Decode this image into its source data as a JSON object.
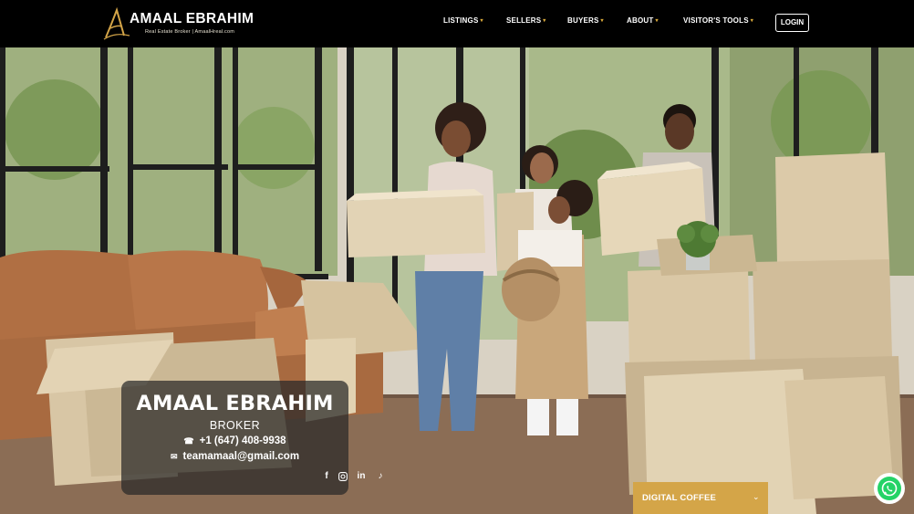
{
  "header": {
    "logo": {
      "name": "AMAAL EBRAHIM",
      "tagline": "Real Estate Broker  |  AmaalHreal.com",
      "mark_script": "A Real"
    },
    "nav": [
      {
        "label": "LISTINGS",
        "has_dropdown": true
      },
      {
        "label": "SELLERS",
        "has_dropdown": true
      },
      {
        "label": "BUYERS",
        "has_dropdown": true
      },
      {
        "label": "ABOUT",
        "has_dropdown": true
      },
      {
        "label": "VISITOR'S TOOLS",
        "has_dropdown": true
      }
    ],
    "login_label": "LOGIN"
  },
  "card": {
    "name": "AMAAL EBRAHIM",
    "role": "BROKER",
    "phone": "+1 (647) 408-9938",
    "email": "teamamaal@gmail.com",
    "socials": [
      "facebook-icon",
      "instagram-icon",
      "linkedin-icon",
      "tiktok-icon"
    ]
  },
  "coffee": {
    "label": "DIGITAL COFFEE"
  },
  "whatsapp": {
    "icon": "whatsapp-icon"
  },
  "colors": {
    "header_bg": "#000000",
    "accent_gold": "#d4a548",
    "card_bg": "rgba(40,40,40,0.72)",
    "whatsapp_green": "#25d366"
  }
}
